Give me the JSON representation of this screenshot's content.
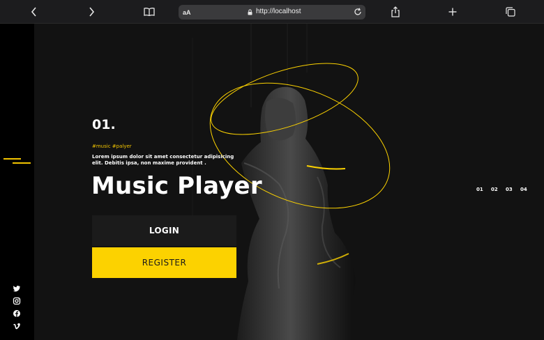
{
  "browser": {
    "address_prefix": "aA",
    "url": "http://localhost",
    "icons": [
      "back-icon",
      "forward-icon",
      "bookmarks-icon",
      "lock-icon",
      "reload-icon",
      "share-icon",
      "new-tab-icon",
      "tabs-icon"
    ]
  },
  "hero": {
    "slide_number": "01.",
    "tags": "#music #palyer",
    "description": "Lorem ipsum dolor sit amet consectetur adipisicing elit. Debitis ipsa, non maxime provident .",
    "title": "Music Player",
    "login_label": "LOGIN",
    "register_label": "REGISTER"
  },
  "pager": [
    "01",
    "02",
    "03",
    "04"
  ],
  "social": [
    "twitter-icon",
    "instagram-icon",
    "facebook-icon",
    "vimeo-icon"
  ],
  "colors": {
    "accent": "#fcd200",
    "background": "#121212",
    "sidebar": "#000000"
  }
}
